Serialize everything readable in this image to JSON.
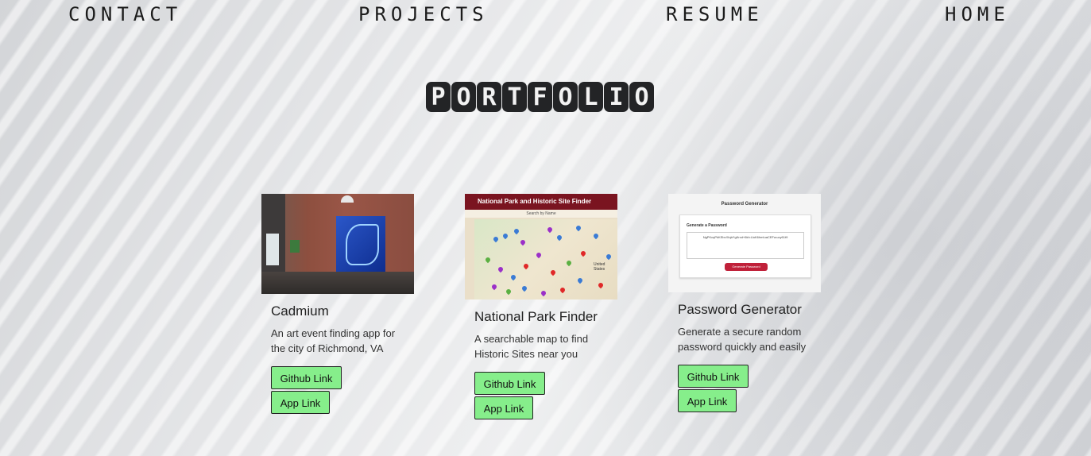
{
  "nav": {
    "contact": "CONTACT",
    "projects": "PROJECTS",
    "resume": "RESUME",
    "home": "HOME"
  },
  "page_title": {
    "letters": [
      "P",
      "O",
      "R",
      "T",
      "F",
      "O",
      "L",
      "I",
      "O"
    ]
  },
  "projects": [
    {
      "title": "Cadmium",
      "description": "An art event finding app for the city of Richmond, VA",
      "github_label": "Github Link",
      "app_label": "App Link"
    },
    {
      "title": "National Park Finder",
      "description": "A searchable map to find Historic Sites near you",
      "github_label": "Github Link",
      "app_label": "App Link",
      "thumbnail": {
        "header": "National Park and Historic Site Finder",
        "search": "Search by Name",
        "map_label": "United States"
      }
    },
    {
      "title": "Password Generator",
      "description": "Generate a secure random password quickly and easily",
      "github_label": "Github Link",
      "app_label": "App Link",
      "thumbnail": {
        "title": "Password Generator",
        "label": "Generate a Password",
        "password": "NgPKcqPkKEbc!Xqb!*gKrxd+6kh:UuK6hm!uaCEFa:ucy61t9",
        "button": "Generate Password"
      }
    }
  ],
  "colors": {
    "button": "#86ee8b",
    "title_tile": "#232426",
    "nav_text": "#1b1b1b"
  }
}
